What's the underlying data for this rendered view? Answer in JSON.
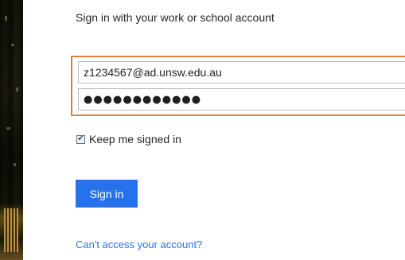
{
  "signin": {
    "headline": "Sign in with your work or school account",
    "username_value": "z1234567@ad.unsw.edu.au",
    "password_value": "●●●●●●●●●●●●",
    "keep_signed_in_label": "Keep me signed in",
    "keep_signed_in_checked": true,
    "check_glyph": "✔",
    "button_label": "Sign in",
    "help_link_label": "Can't access your account?"
  },
  "colors": {
    "accent": "#2672ec",
    "focus_outline": "#e0823d",
    "text": "#262626"
  }
}
